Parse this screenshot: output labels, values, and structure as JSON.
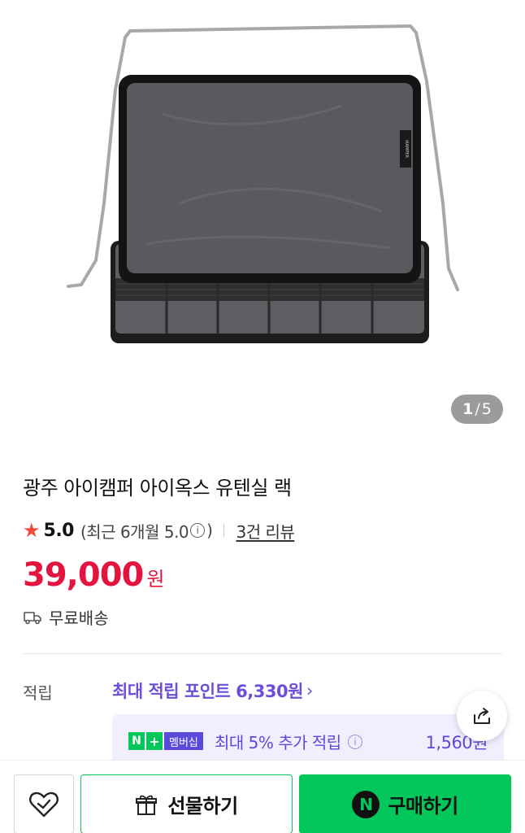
{
  "gallery": {
    "current_page": "1",
    "separator": "/",
    "total_pages": "5",
    "brand_tag": "iKAMPER"
  },
  "product": {
    "title": "광주 아이캠퍼 아이옥스 유텐실 랙",
    "rating_score": "5.0",
    "rating_recent": "(최근 6개월 5.0",
    "rating_recent_close": ")",
    "review_link": "3건 리뷰",
    "price": "39,000",
    "currency": "원",
    "shipping": "무료배송"
  },
  "points": {
    "label": "적립",
    "max_points_link": "최대 적립 포인트 6,330원",
    "membership_badge_n": "N",
    "membership_badge_plus": "+",
    "membership_badge_label": "멤버십",
    "membership_text": "최대 5% 추가 적립",
    "membership_amount": "1,560원"
  },
  "bottom_bar": {
    "gift_label": "선물하기",
    "buy_label": "구매하기",
    "npay_letter": "N"
  },
  "colors": {
    "price_red": "#e3143d",
    "naver_green": "#03c75a",
    "membership_purple": "#5b4ad9",
    "star": "#f04a3b"
  },
  "icons": [
    "star-icon",
    "info-icon",
    "truck-icon",
    "chevron-right-icon",
    "share-icon",
    "heart-check-icon",
    "gift-icon",
    "npay-icon"
  ]
}
